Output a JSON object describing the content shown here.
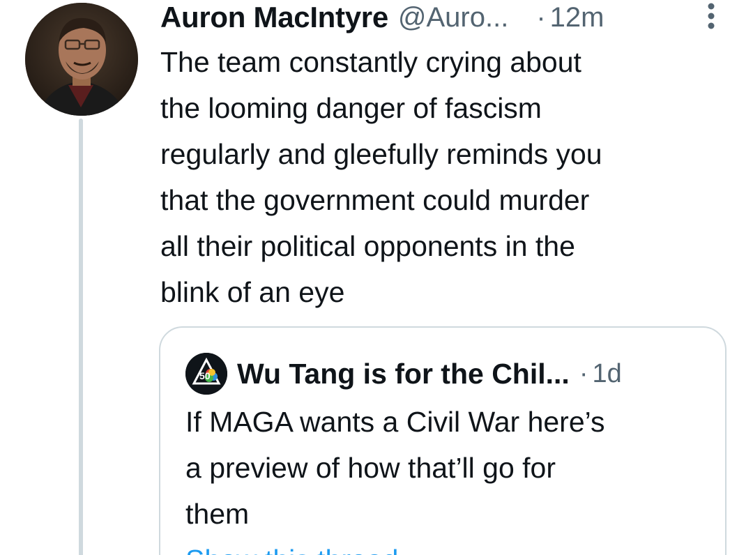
{
  "tweet": {
    "author_name": "Auron MacIntyre",
    "author_handle": "@Auro...",
    "separator": "·",
    "time": "12m",
    "text_lines": [
      "The team constantly crying about",
      "the looming danger of fascism",
      "regularly and gleefully reminds you",
      "that the government could murder",
      "all their political opponents in the",
      "blink of an eye"
    ]
  },
  "quote": {
    "author_name": "Wu Tang is for the Chil...",
    "separator": "·",
    "time": "1d",
    "avatar_label": "50",
    "text_lines": [
      "If MAGA wants a Civil War here’s",
      "a preview of how that’ll go for",
      "them"
    ],
    "show_thread_label": "Show this thread"
  },
  "colors": {
    "text": "#0f1419",
    "secondary": "#536471",
    "border": "#cfd9de",
    "link": "#1d9bf0"
  }
}
